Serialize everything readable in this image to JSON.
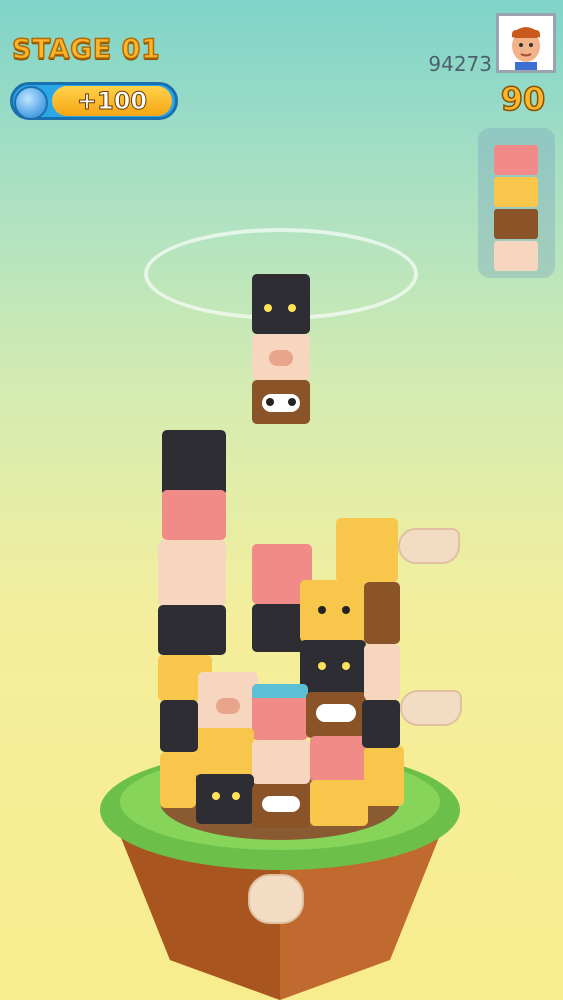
{
  "hud": {
    "stage_label": "STAGE 01",
    "reward_label": "+100",
    "score": "94273",
    "counter": "90",
    "avatar_icon": "player-avatar-icon"
  },
  "next_queue": {
    "blocks": [
      {
        "animal": "pig",
        "color": "#f28a8a"
      },
      {
        "animal": "chick",
        "color": "#f7c64a"
      },
      {
        "animal": "raccoon",
        "color": "#8a5428"
      },
      {
        "animal": "pig",
        "color": "#f6d6bf"
      }
    ]
  },
  "falling_stack": {
    "blocks": [
      {
        "animal": "cat",
        "color": "#2e2d33"
      },
      {
        "animal": "pig",
        "color": "#f6d6bf"
      },
      {
        "animal": "raccoon",
        "color": "#8a5428"
      }
    ]
  },
  "colors": {
    "accent": "#ffb62c",
    "grass": "#6cc04a",
    "soil": "#c06a2f"
  }
}
